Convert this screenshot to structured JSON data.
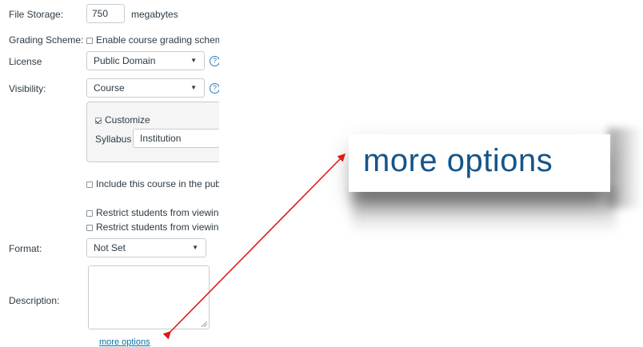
{
  "file_storage": {
    "label": "File Storage:",
    "value": "750",
    "unit": "megabytes"
  },
  "grading_scheme": {
    "label": "Grading Scheme:",
    "checkbox_label": "Enable course grading scheme"
  },
  "license": {
    "label": "License",
    "selected": "Public Domain"
  },
  "visibility": {
    "label": "Visibility:",
    "selected": "Course",
    "customize_label": "Customize",
    "syllabus_label": "Syllabus",
    "syllabus_selected": "Institution"
  },
  "include_public": {
    "label": "Include this course in the public course index"
  },
  "restrict": [
    {
      "label": "Restrict students from viewing course before start date"
    },
    {
      "label": "Restrict students from viewing course after end date"
    }
  ],
  "format": {
    "label": "Format:",
    "selected": "Not Set"
  },
  "description": {
    "label": "Description:",
    "value": ""
  },
  "more_options": {
    "label": "more options",
    "zoom_label": "more options"
  },
  "icons": {
    "help": "?",
    "caret": "▼"
  },
  "colors": {
    "link": "#0770a3",
    "arrow": "#e0191a",
    "zoom_text": "#14558a"
  }
}
